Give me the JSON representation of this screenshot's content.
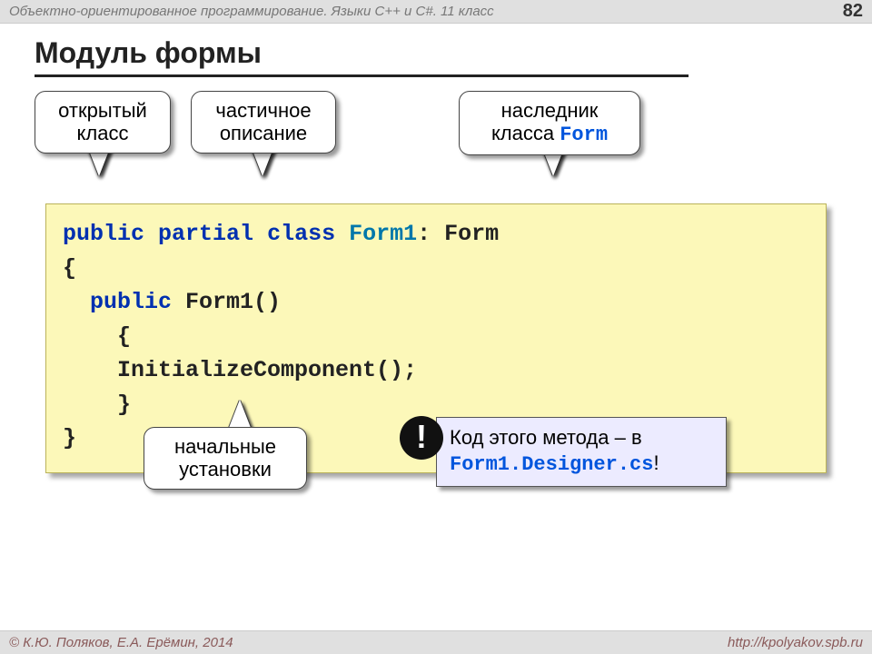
{
  "header": {
    "course": "Объектно-ориентированное программирование. Языки C++ и C#. 11 класс",
    "page": "82"
  },
  "title": "Модуль формы",
  "callouts": {
    "public": {
      "line1": "открытый",
      "line2": "класс"
    },
    "partial": {
      "line1": "частичное",
      "line2": "описание"
    },
    "inherit": {
      "line1": "наследник",
      "line2_a": "класса ",
      "line2_b": "Form"
    },
    "initial": {
      "line1": "начальные",
      "line2": "установки"
    }
  },
  "code": {
    "l1a": "public",
    "l1b": " ",
    "l1c": "partial",
    "l1d": " ",
    "l1e": "class",
    "l1f": " ",
    "l1g": "Form1",
    "l1h": ": Form",
    "l2": "{",
    "l3a": "  ",
    "l3b": "public",
    "l3c": " Form1()",
    "l4": "    {",
    "l5": "    InitializeComponent();",
    "l6": "    }",
    "l7": "}"
  },
  "info": {
    "bang": "!",
    "text1": "Код этого метода – в",
    "text2": "Form1.Designer.cs",
    "text3": "!"
  },
  "footer": {
    "left": "© К.Ю. Поляков, Е.А. Ерёмин, 2014",
    "right": "http://kpolyakov.spb.ru"
  }
}
